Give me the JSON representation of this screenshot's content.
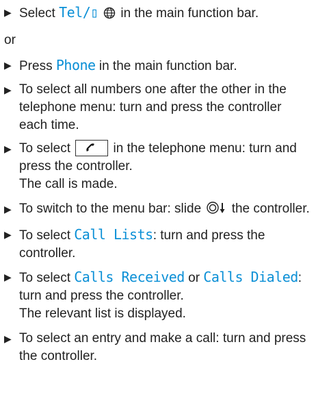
{
  "steps_a": [
    {
      "pre": "Select ",
      "menu": "Tel/▯",
      "post": " in the main function bar."
    }
  ],
  "or_label": "or",
  "steps_b": {
    "press_phone": {
      "pre": "Press ",
      "menu": "Phone",
      "post": " in the main function bar."
    },
    "select_numbers": "To select all numbers one after the other in the telephone menu: turn and press the controller each time.",
    "select_call_pre": "To select ",
    "select_call_post": " in the telephone menu: turn and press the controller.",
    "call_made": "The call is made.",
    "switch_menu_pre": "To switch to the menu bar: slide ",
    "switch_menu_post": " the controller.",
    "call_lists": {
      "pre": "To select ",
      "menu": "Call Lists",
      "post": ": turn and press the controller."
    },
    "calls_select": {
      "pre": "To select ",
      "menu1": "Calls Received",
      "mid": " or ",
      "menu2": "Calls Dialed",
      "post": ": turn and press the controller."
    },
    "list_displayed": "The relevant list is displayed.",
    "entry_call": "To select an entry and make a call: turn and press the controller."
  },
  "icons": {
    "bullet": "triangle-bullet",
    "globe": "globe-icon",
    "phone": "phone-handset-icon",
    "controller": "controller-slide-down-icon"
  },
  "colors": {
    "menu_text": "#0a8fd6",
    "body_text": "#222222"
  }
}
